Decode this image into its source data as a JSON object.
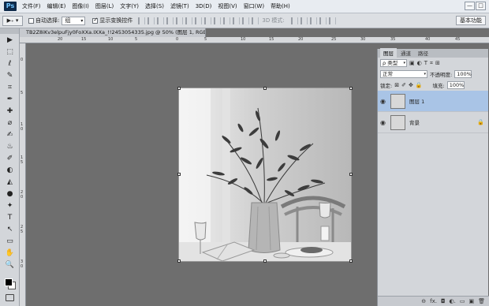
{
  "app": {
    "logo": "Ps"
  },
  "menu": [
    "文件(F)",
    "编辑(E)",
    "图像(I)",
    "图层(L)",
    "文字(Y)",
    "选择(S)",
    "滤镜(T)",
    "3D(D)",
    "视图(V)",
    "窗口(W)",
    "帮助(H)"
  ],
  "window_controls": {
    "minimize": "—",
    "maximize": "□"
  },
  "options": {
    "tool_label": "▶₊ ▾",
    "auto_select_label": "自动选择:",
    "auto_select_value": "组",
    "show_transform_label": "显示变换控件",
    "mode_3d_label": "3D 模式:",
    "workspace": "基本功能"
  },
  "document": {
    "tab_title": "TB2Z8iKv3elpuFjy0FoXXa.IXXa_!!2453054335.jpg @ 50% (图层 1, RGB/8#) *",
    "close": "×",
    "ruler_top": [
      "20",
      "15",
      "10",
      "5",
      "0",
      "5",
      "10",
      "15",
      "20",
      "25",
      "30",
      "35",
      "40",
      "45"
    ],
    "ruler_left": [
      "0",
      "5",
      "1\n0",
      "1\n5",
      "2\n0",
      "2\n5",
      "3\n0"
    ]
  },
  "tools": [
    "▶",
    "⬚",
    "ℓ",
    "✎",
    "⌗",
    "✒",
    "✚",
    "⌀",
    "✍",
    "♨",
    "✐",
    "◐",
    "◭",
    "●",
    "✦",
    "T",
    "↖",
    "▭",
    "✋",
    "🔍"
  ],
  "layers_panel": {
    "tabs": [
      "图层",
      "通道",
      "路径"
    ],
    "filter_kind": "ρ 类型",
    "blend_mode": "正常",
    "opacity_label": "不透明度:",
    "opacity_value": "100%",
    "lock_label": "锁定:",
    "fill_label": "填充:",
    "fill_value": "100%",
    "layers": [
      {
        "name": "图层 1",
        "selected": true
      },
      {
        "name": "背景",
        "selected": false,
        "locked": true
      }
    ],
    "bottom_icons": [
      "⊖",
      "fx.",
      "◘",
      "◐.",
      "▭",
      "▣",
      "🗑"
    ]
  }
}
